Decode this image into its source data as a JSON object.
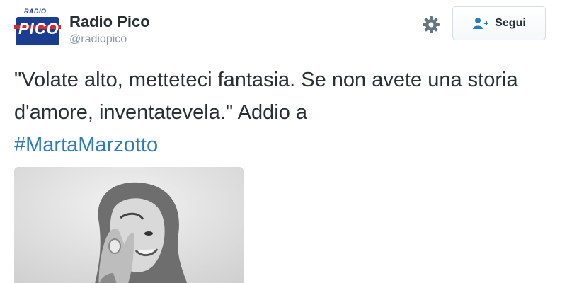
{
  "account": {
    "avatar_top_text": "RADIO",
    "avatar_main_text": "PICO",
    "display_name": "Radio Pico",
    "handle": "@radiopico"
  },
  "actions": {
    "settings_icon": "gear-icon",
    "follow_label": "Segui",
    "follow_icon": "add-user-icon"
  },
  "tweet": {
    "text_before": "\"Volate alto, metteteci fantasia. Se non avete una storia d'amore, inventatevela.\" Addio a ",
    "hashtag": "#MartaMarzotto"
  },
  "colors": {
    "link": "#2b7bb9",
    "text": "#292f33",
    "muted": "#8899a6",
    "brand_blue": "#1a3d8f",
    "brand_red": "#d32a2a"
  }
}
